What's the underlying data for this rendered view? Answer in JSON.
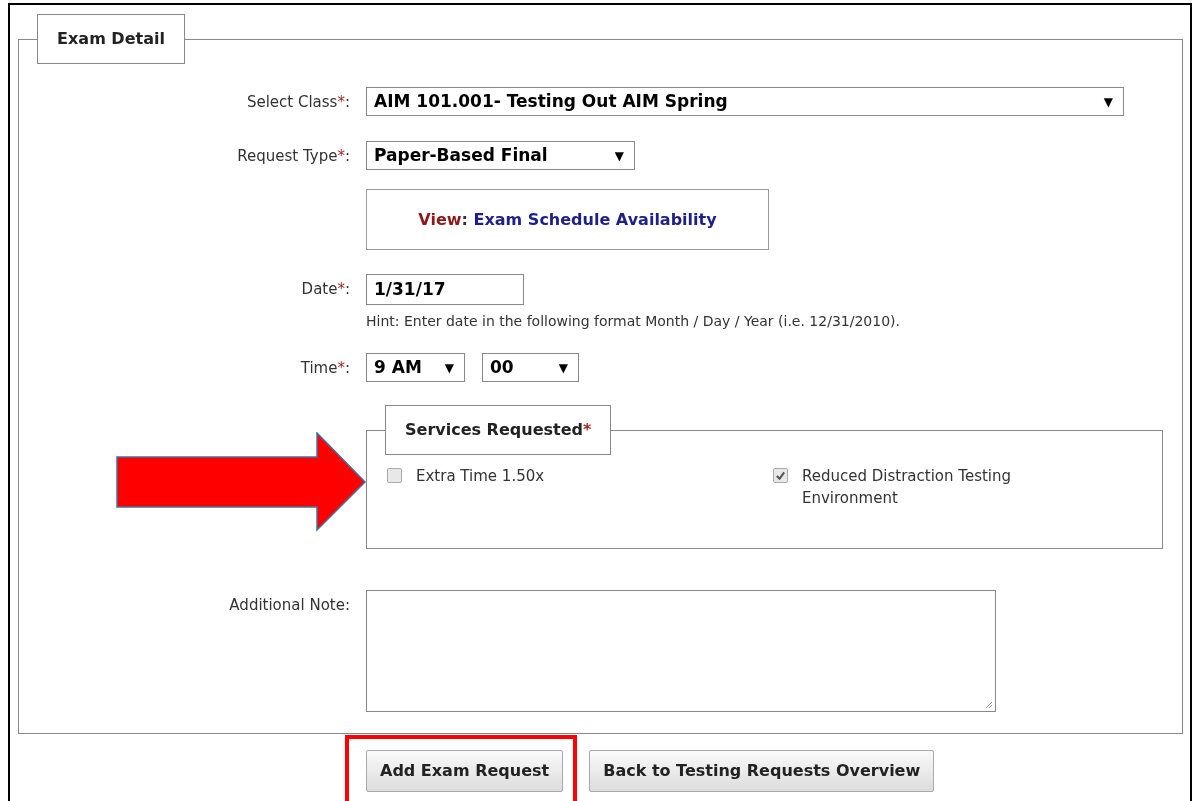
{
  "legend": "Exam Detail",
  "fields": [
    {
      "kind": "wide_select",
      "label": "Select Class",
      "mark": "*",
      "suffix": ":",
      "value": "AIM 101.001- Testing Out AIM Spring",
      "caret": "▼"
    },
    {
      "kind": "short_select",
      "label": "Request Type",
      "mark": "*",
      "suffix": ":",
      "value": "Paper-Based Final",
      "caret": "▼"
    },
    {
      "kind": "link_box",
      "prefix": "View",
      "separator": ":",
      "link": "Exam Schedule Availability"
    },
    {
      "kind": "date",
      "label": "Date",
      "mark": "*",
      "suffix": ":",
      "value": "1/31/17",
      "hint": "Hint: Enter date in the following format Month / Day / Year (i.e. 12/31/2010)."
    },
    {
      "kind": "time",
      "label": "Time",
      "mark": "*",
      "suffix": ":",
      "selects": [
        {
          "value": "9 AM",
          "caret": "▼"
        },
        {
          "value": "00",
          "caret": "▼"
        }
      ]
    },
    {
      "kind": "services",
      "legend": "Services Requested",
      "mark": "*",
      "options": [
        {
          "label": "Extra Time 1.50x",
          "checked": false
        },
        {
          "label": "Reduced Distraction Testing Environment",
          "checked": true
        }
      ]
    },
    {
      "kind": "textarea",
      "label": "Additional Note",
      "suffix": ":"
    }
  ],
  "buttons": [
    {
      "label": "Add Exam Request",
      "highlighted": true
    },
    {
      "label": "Back to Testing Requests Overview",
      "highlighted": false
    }
  ],
  "arrow_pointer": true
}
